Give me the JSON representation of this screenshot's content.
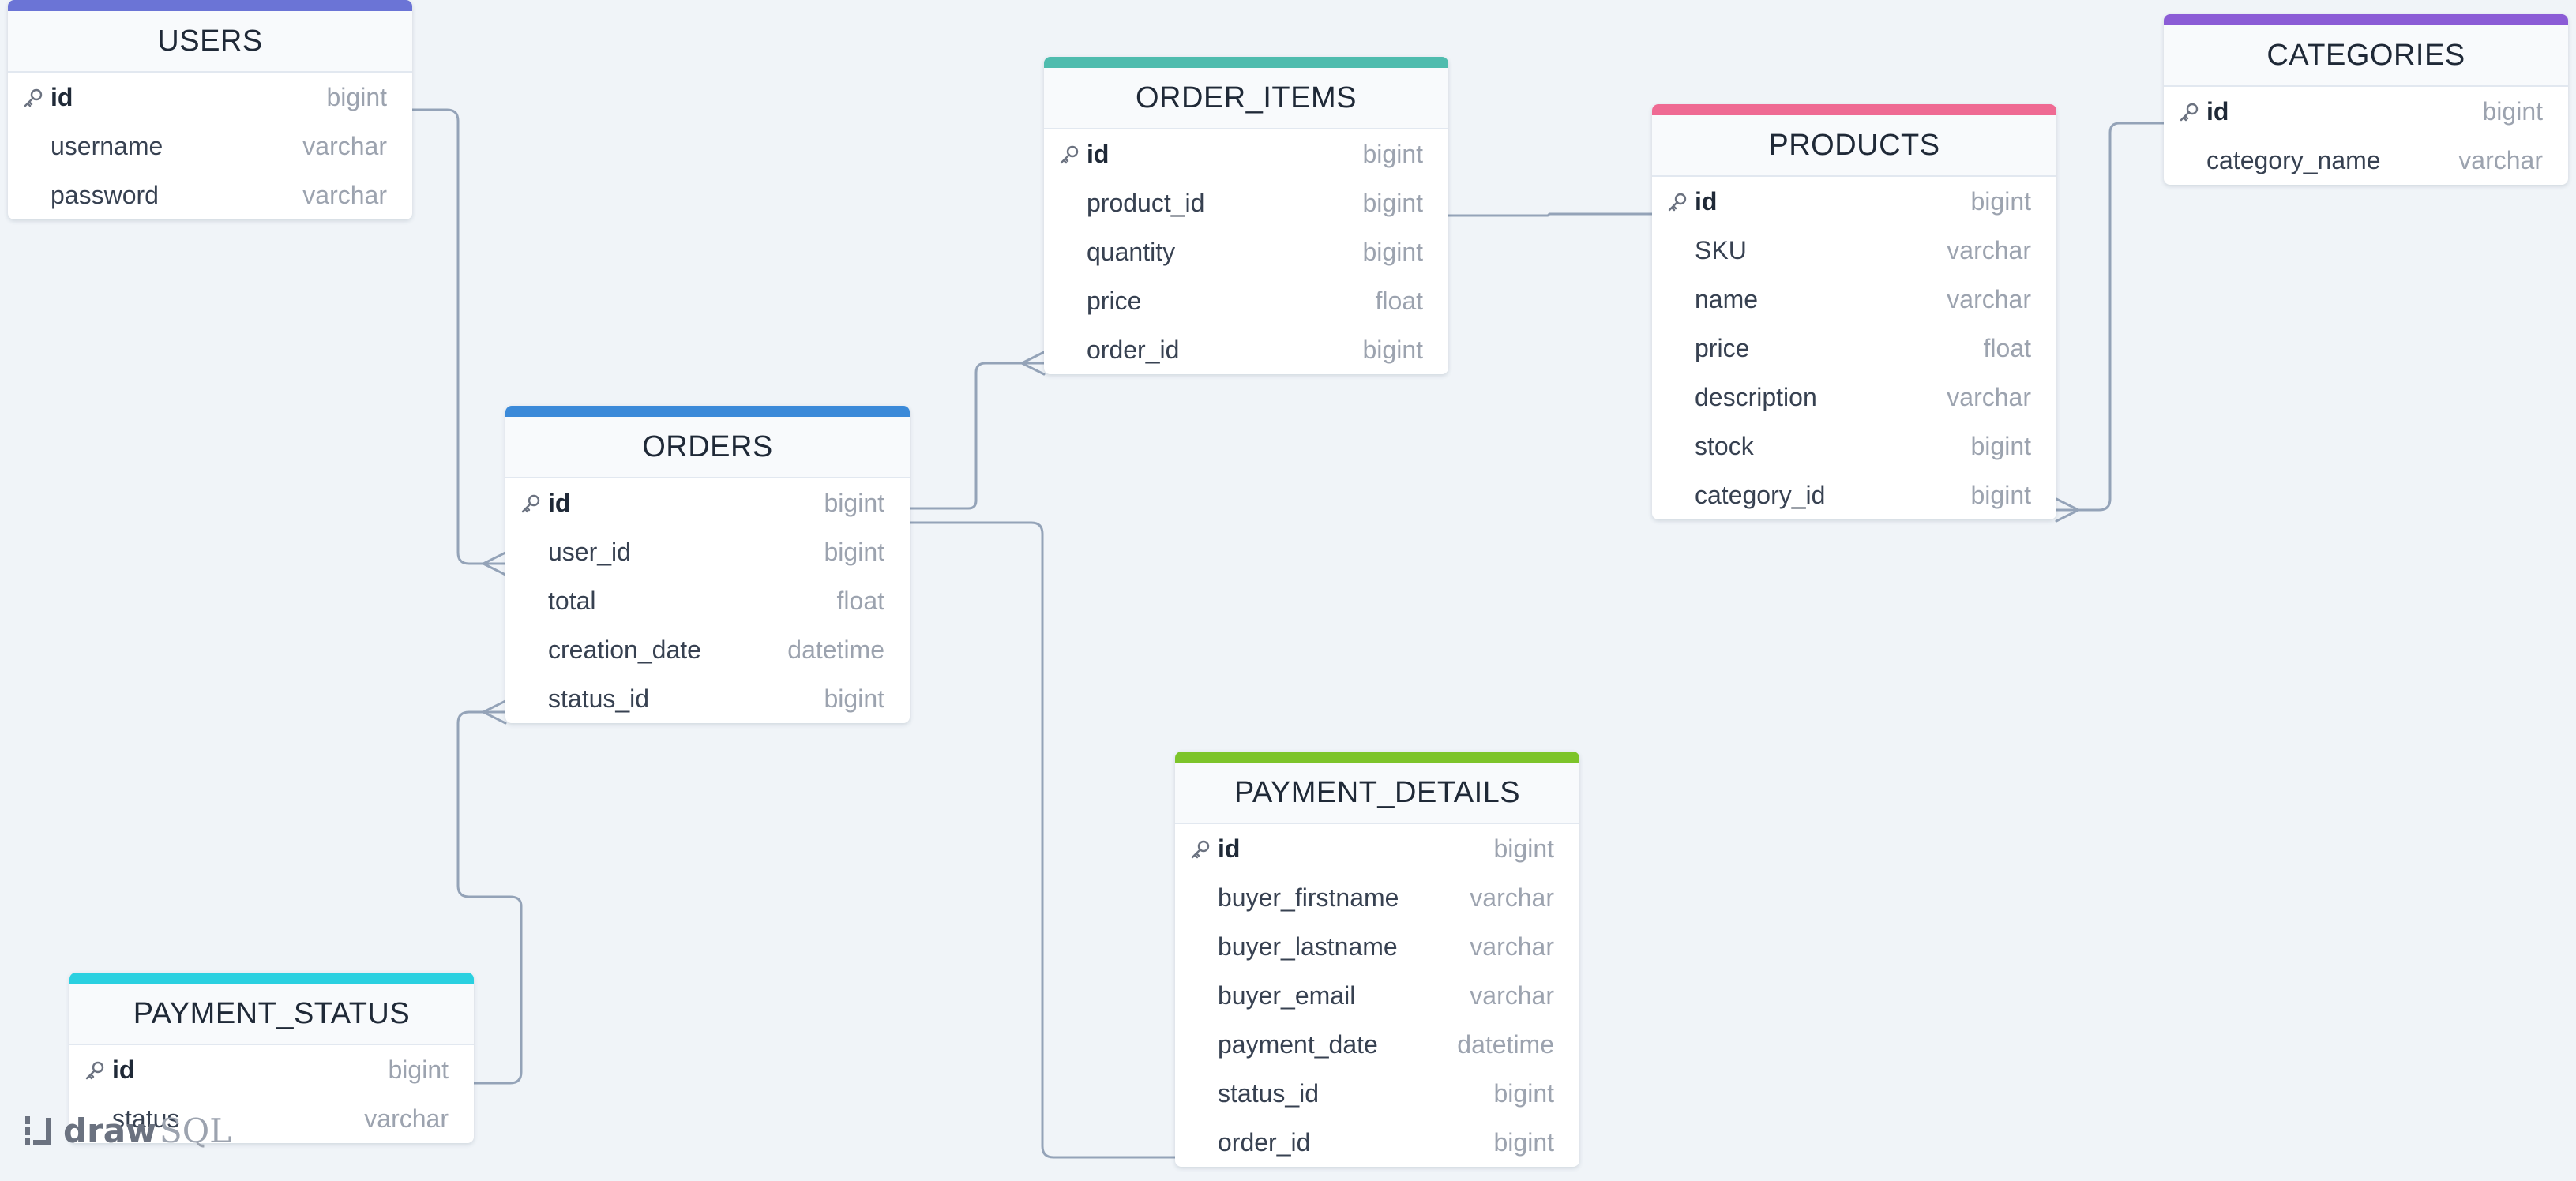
{
  "app": {
    "logo_part1": "draw",
    "logo_part2": "SQL"
  },
  "colors": {
    "connector": "#94a3b8",
    "users": "#6b74d6",
    "order_items": "#4fbcae",
    "products": "#ef6a93",
    "categories": "#8b5cd6",
    "orders": "#3b8ad9",
    "payment_details": "#7dc42a",
    "payment_status": "#2ad0e0"
  },
  "tables": {
    "users": {
      "title": "USERS",
      "columns": [
        {
          "name": "id",
          "type": "bigint",
          "pk": true
        },
        {
          "name": "username",
          "type": "varchar"
        },
        {
          "name": "password",
          "type": "varchar"
        }
      ]
    },
    "order_items": {
      "title": "ORDER_ITEMS",
      "columns": [
        {
          "name": "id",
          "type": "bigint",
          "pk": true
        },
        {
          "name": "product_id",
          "type": "bigint"
        },
        {
          "name": "quantity",
          "type": "bigint"
        },
        {
          "name": "price",
          "type": "float"
        },
        {
          "name": "order_id",
          "type": "bigint"
        }
      ]
    },
    "products": {
      "title": "PRODUCTS",
      "columns": [
        {
          "name": "id",
          "type": "bigint",
          "pk": true
        },
        {
          "name": "SKU",
          "type": "varchar"
        },
        {
          "name": "name",
          "type": "varchar"
        },
        {
          "name": "price",
          "type": "float"
        },
        {
          "name": "description",
          "type": "varchar"
        },
        {
          "name": "stock",
          "type": "bigint"
        },
        {
          "name": "category_id",
          "type": "bigint"
        }
      ]
    },
    "categories": {
      "title": "CATEGORIES",
      "columns": [
        {
          "name": "id",
          "type": "bigint",
          "pk": true
        },
        {
          "name": "category_name",
          "type": "varchar"
        }
      ]
    },
    "orders": {
      "title": "ORDERS",
      "columns": [
        {
          "name": "id",
          "type": "bigint",
          "pk": true
        },
        {
          "name": "user_id",
          "type": "bigint"
        },
        {
          "name": "total",
          "type": "float"
        },
        {
          "name": "creation_date",
          "type": "datetime"
        },
        {
          "name": "status_id",
          "type": "bigint"
        }
      ]
    },
    "payment_details": {
      "title": "PAYMENT_DETAILS",
      "columns": [
        {
          "name": "id",
          "type": "bigint",
          "pk": true
        },
        {
          "name": "buyer_firstname",
          "type": "varchar"
        },
        {
          "name": "buyer_lastname",
          "type": "varchar"
        },
        {
          "name": "buyer_email",
          "type": "varchar"
        },
        {
          "name": "payment_date",
          "type": "datetime"
        },
        {
          "name": "status_id",
          "type": "bigint"
        },
        {
          "name": "order_id",
          "type": "bigint"
        }
      ]
    },
    "payment_status": {
      "title": "PAYMENT_STATUS",
      "columns": [
        {
          "name": "id",
          "type": "bigint",
          "pk": true
        },
        {
          "name": "status",
          "type": "varchar"
        }
      ]
    }
  }
}
